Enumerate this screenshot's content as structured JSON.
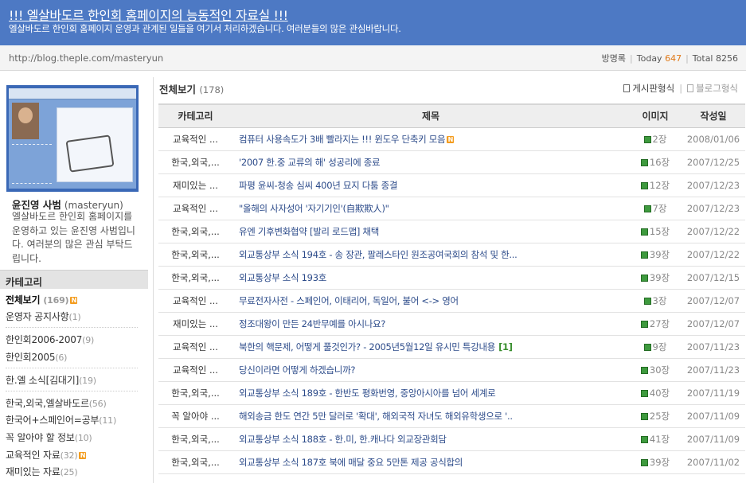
{
  "header": {
    "title": "!!! 엘살바도르 한인회 홈페이지의 능동적인 자료실 !!!",
    "subtitle": "엘살바도르 한인회 홈페이지 운영과 관계된 일들을 여기서 처리하겠습니다. 여러분들의 많은 관심바랍니다."
  },
  "topbar": {
    "url": "http://blog.theple.com/masteryun",
    "guestbook": "방명록",
    "today_label": "Today",
    "today_count": "647",
    "total_label": "Total",
    "total_count": "8256"
  },
  "profile": {
    "name": "윤진영 사범",
    "id": "(masteryun)",
    "intro": "엘살바도르 한인회 홈페이지를 운영하고 있는 윤진영 사범입니다. 여러분의 많은 관심 부탁드립니다."
  },
  "sidebar": {
    "category_header": "카테고리",
    "new_badge": "N",
    "categories": [
      {
        "label": "전체보기",
        "count": "(169)"
      },
      {
        "label": "운영자 공지사항",
        "count": "(1)"
      },
      {
        "label": "한인회2006-2007",
        "count": "(9)"
      },
      {
        "label": "한인회2005",
        "count": "(6)"
      },
      {
        "label": "한.엘 소식[김대기]",
        "count": "(19)"
      },
      {
        "label": "한국,외국,엘살바도르",
        "count": "(56)"
      },
      {
        "label": "한국어+스페인어=공부",
        "count": "(11)"
      },
      {
        "label": "꼭 알아야 할 정보",
        "count": "(10)"
      },
      {
        "label": "교육적인 자료",
        "count": "(32)"
      },
      {
        "label": "재미있는 자료",
        "count": "(25)"
      }
    ]
  },
  "main": {
    "title": "전체보기",
    "count": "(178)",
    "view_board": "게시판형식",
    "view_blog": "블로그형식",
    "columns": [
      "카테고리",
      "제목",
      "이미지",
      "작성일"
    ],
    "rows": [
      {
        "category": "교육적인 ...",
        "title": "컴퓨터 사용속도가 3배 빨라지는 !!! 윈도우 단축키 모음",
        "badge": "N",
        "comments": "",
        "images": "2장",
        "date": "2008/01/06"
      },
      {
        "category": "한국,외국,...",
        "title": "'2007 한.중 교류의 해' 성공리에 종료",
        "badge": "",
        "comments": "",
        "images": "16장",
        "date": "2007/12/25"
      },
      {
        "category": "재미있는 ...",
        "title": "파평 윤씨-청송 심씨 400년 묘지 다툼 종결",
        "badge": "",
        "comments": "",
        "images": "12장",
        "date": "2007/12/23"
      },
      {
        "category": "교육적인 ...",
        "title": "\"올해의 사자성어 '자기기인'(自欺欺人)\"",
        "badge": "",
        "comments": "",
        "images": "7장",
        "date": "2007/12/23"
      },
      {
        "category": "한국,외국,...",
        "title": "유엔 기후변화협약 [발리 로드맵] 채택",
        "badge": "",
        "comments": "",
        "images": "15장",
        "date": "2007/12/22"
      },
      {
        "category": "한국,외국,...",
        "title": "외교통상부 소식 194호 - 송 장관, 팔레스타인 원조공여국회의 참석 및 한...",
        "badge": "",
        "comments": "",
        "images": "39장",
        "date": "2007/12/22"
      },
      {
        "category": "한국,외국,...",
        "title": "외교통상부 소식 193호",
        "badge": "",
        "comments": "",
        "images": "39장",
        "date": "2007/12/15"
      },
      {
        "category": "교육적인 ...",
        "title": "무료전자사전 - 스페인어, 이태리어, 독일어, 불어 <-> 영어",
        "badge": "",
        "comments": "",
        "images": "3장",
        "date": "2007/12/07"
      },
      {
        "category": "재미있는 ...",
        "title": "정조대왕이 만든 24반무예를 아시나요?",
        "badge": "",
        "comments": "",
        "images": "27장",
        "date": "2007/12/07"
      },
      {
        "category": "교육적인 ...",
        "title": "북한의 핵문제, 어떻게 풀것인가? - 2005년5월12일 유시민 특강내용",
        "badge": "",
        "comments": "[1]",
        "images": "9장",
        "date": "2007/11/23"
      },
      {
        "category": "교육적인 ...",
        "title": "당신이라면 어떻게 하겠습니까?",
        "badge": "",
        "comments": "",
        "images": "30장",
        "date": "2007/11/23"
      },
      {
        "category": "한국,외국,...",
        "title": "외교통상부 소식 189호 - 한반도 평화번영, 중앙아시아를 넘어 세계로",
        "badge": "",
        "comments": "",
        "images": "40장",
        "date": "2007/11/19"
      },
      {
        "category": "꼭 알아야 ...",
        "title": "해외송금 한도 연간 5만 달러로 '확대', 해외국적 자녀도 해외유학생으로 '..",
        "badge": "",
        "comments": "",
        "images": "25장",
        "date": "2007/11/09"
      },
      {
        "category": "한국,외국,...",
        "title": "외교통상부 소식 188호 - 한.미, 한.캐나다 외교장관회담",
        "badge": "",
        "comments": "",
        "images": "41장",
        "date": "2007/11/09"
      },
      {
        "category": "한국,외국,...",
        "title": "외교통상부 소식 187호 북에 매달 중요 5만톤 제공 공식합의",
        "badge": "",
        "comments": "",
        "images": "39장",
        "date": "2007/11/02"
      }
    ]
  }
}
